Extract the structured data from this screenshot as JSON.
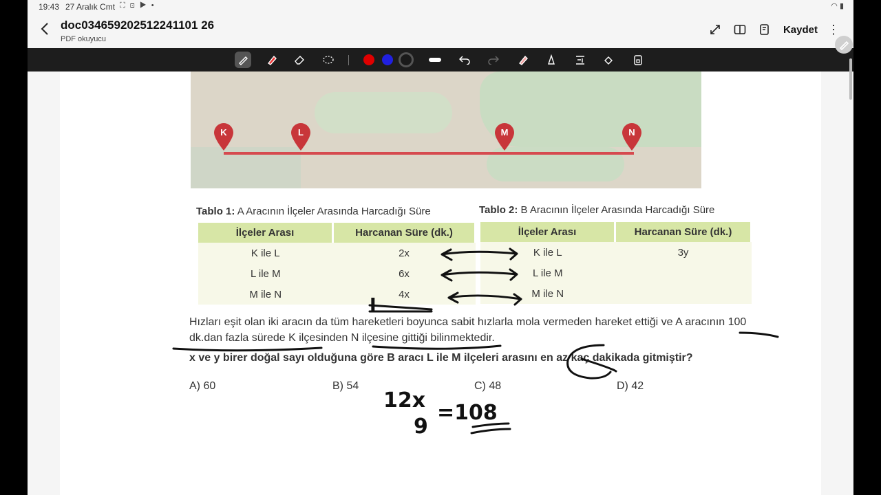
{
  "status_bar": {
    "time": "19:43",
    "date": "27 Aralık Cmt",
    "icons": [
      "screen-icon",
      "record-icon",
      "youtube-icon",
      "dot-icon"
    ],
    "right_icons": [
      "wifi-icon",
      "battery-icon"
    ]
  },
  "app_bar": {
    "title": "doc034659202512241101 26",
    "subtitle": "PDF okuyucu",
    "save_label": "Kaydet"
  },
  "toolbar": {
    "tools": [
      "pen-icon",
      "highlighter-icon",
      "eraser-icon",
      "lasso-icon"
    ],
    "colors": [
      "#e00000",
      "#2020e0",
      "#1a1a1a"
    ],
    "actions": [
      "stroke-width-icon",
      "undo-icon",
      "redo-icon",
      "ruler-pen-icon",
      "shape-icon",
      "text-recognition-icon",
      "fill-icon",
      "lock-icon"
    ]
  },
  "map": {
    "pins": [
      "K",
      "L",
      "M",
      "N"
    ],
    "route_color": "#d64a4f"
  },
  "table1": {
    "caption_bold": "Tablo 1:",
    "caption_rest": " A Aracının İlçeler Arasında Harcadığı Süre",
    "headers": [
      "İlçeler Arası",
      "Harcanan Süre (dk.)"
    ],
    "rows": [
      [
        "K ile L",
        "2x"
      ],
      [
        "L ile M",
        "6x"
      ],
      [
        "M ile N",
        "4x"
      ]
    ]
  },
  "table2": {
    "caption_bold": "Tablo 2:",
    "caption_rest": " B Aracının İlçeler Arasında Harcadığı Süre",
    "headers": [
      "İlçeler Arası",
      "Harcanan Süre (dk.)"
    ],
    "rows": [
      [
        "K ile L",
        "3y"
      ],
      [
        "L ile M",
        ""
      ],
      [
        "M ile N",
        ""
      ]
    ]
  },
  "question": {
    "text": "Hızları eşit olan iki aracın da tüm hareketleri boyunca sabit hızlarla mola vermeden hareket ettiği ve A aracının 100 dk.dan fazla sürede K ilçesinden N ilçesine gittiği bilinmektedir.",
    "bold_text": "x ve y birer doğal sayı olduğuna göre B aracı L ile M ilçeleri arasını en az kaç dakikada gitmiştir?"
  },
  "options": [
    "A) 60",
    "B) 54",
    "C) 48",
    "D) 42"
  ],
  "handwriting": {
    "numerator": "12x",
    "denominator": "9",
    "result": "=108",
    "mark": "I"
  }
}
